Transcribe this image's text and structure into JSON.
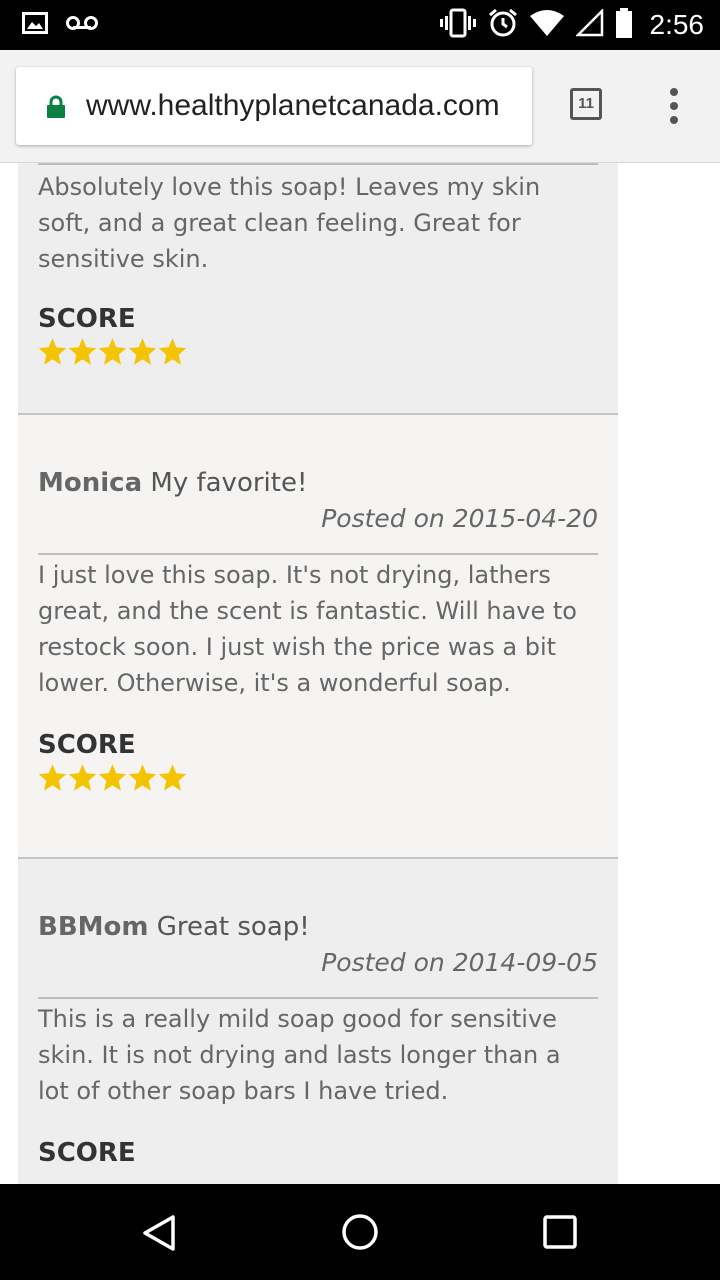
{
  "status_bar": {
    "time": "2:56",
    "icons": [
      "image-icon",
      "voicemail-icon",
      "vibrate-icon",
      "alarm-icon",
      "wifi-icon",
      "signal-icon",
      "battery-icon"
    ]
  },
  "browser": {
    "url": "www.healthyplanetcanada.com",
    "tab_count": "11",
    "secure_color": "#0b8043"
  },
  "reviews": [
    {
      "body": "Absolutely love this soap! Leaves my skin soft, and a great clean feeling. Great for sensitive skin.",
      "score_label": "SCORE",
      "rating": 5
    },
    {
      "author": "Monica",
      "title": "My favorite!",
      "date": "Posted on 2015-04-20",
      "body": "I just love this soap. It's not drying, lathers great, and the scent is fantastic. Will have to restock soon. I just wish the price was a bit lower. Otherwise, it's a wonderful soap.",
      "score_label": "SCORE",
      "rating": 5
    },
    {
      "author": "BBMom",
      "title": "Great soap!",
      "date": "Posted on 2014-09-05",
      "body": "This is a really mild soap good for sensitive skin. It is not drying and lasts longer than a lot of other soap bars I have tried.",
      "score_label": "SCORE"
    }
  ],
  "colors": {
    "star": "#f5c400"
  },
  "nav": [
    "back-icon",
    "home-icon",
    "recents-icon"
  ]
}
